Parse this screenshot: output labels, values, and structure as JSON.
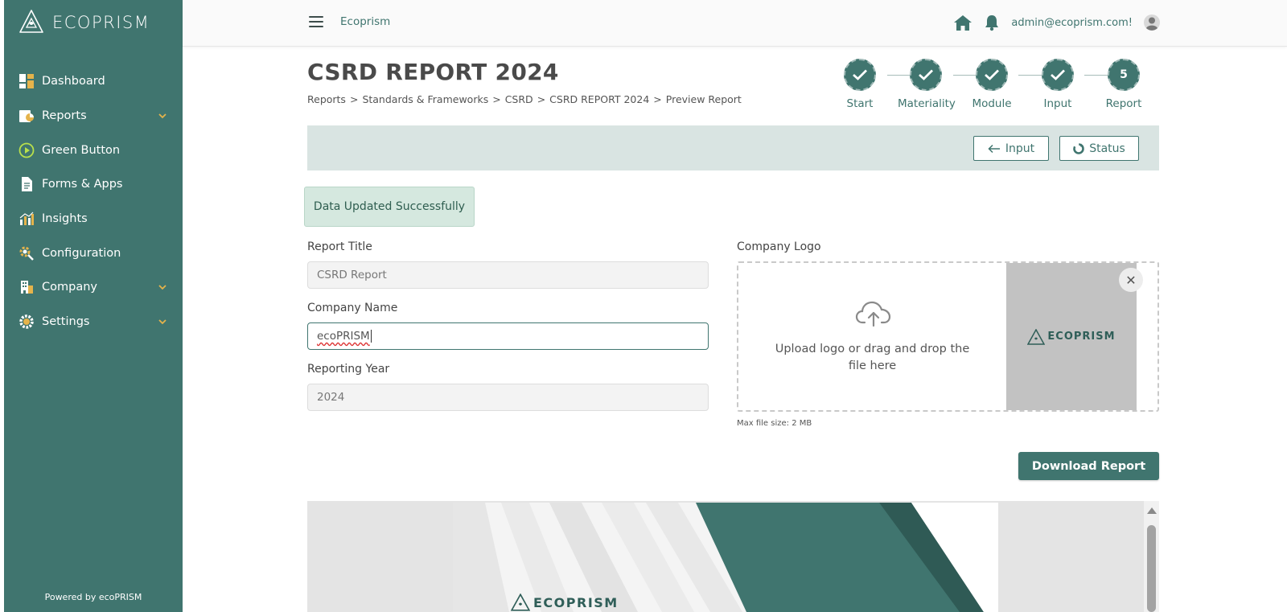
{
  "brand": {
    "name": "ECOPRISM"
  },
  "sidebar": {
    "items": [
      {
        "label": "Dashboard",
        "icon": "dashboard-icon",
        "has_chevron": false
      },
      {
        "label": "Reports",
        "icon": "reports-icon",
        "has_chevron": true
      },
      {
        "label": "Green Button",
        "icon": "play-circle-icon",
        "has_chevron": false
      },
      {
        "label": "Forms & Apps",
        "icon": "document-icon",
        "has_chevron": false
      },
      {
        "label": "Insights",
        "icon": "bar-chart-icon",
        "has_chevron": false
      },
      {
        "label": "Configuration",
        "icon": "gear-search-icon",
        "has_chevron": false
      },
      {
        "label": "Company",
        "icon": "building-icon",
        "has_chevron": true
      },
      {
        "label": "Settings",
        "icon": "settings-icon",
        "has_chevron": true
      }
    ],
    "powered_by": "Powered by ecoPRISM"
  },
  "header": {
    "title": "Ecoprism",
    "email": "admin@ecoprism.com!"
  },
  "page": {
    "title": "CSRD REPORT 2024",
    "breadcrumb": [
      "Reports",
      "Standards & Frameworks",
      "CSRD",
      "CSRD REPORT 2024",
      "Preview Report"
    ]
  },
  "stepper": {
    "steps": [
      {
        "label": "Start",
        "done": true
      },
      {
        "label": "Materiality",
        "done": true
      },
      {
        "label": "Module",
        "done": true
      },
      {
        "label": "Input",
        "done": true
      },
      {
        "label": "Report",
        "done": false,
        "number": "5"
      }
    ]
  },
  "actions": {
    "input_label": "Input",
    "status_label": "Status"
  },
  "toast": {
    "message": "Data Updated Successfully"
  },
  "form": {
    "report_title_label": "Report Title",
    "report_title_value": "CSRD Report",
    "company_name_label": "Company Name",
    "company_name_value": "ecoPRISM",
    "reporting_year_label": "Reporting Year",
    "reporting_year_value": "2024",
    "company_logo_label": "Company Logo",
    "upload_text": "Upload logo or drag and drop the file here",
    "preview_logo_text": "ECOPRISM",
    "max_size": "Max file size: 2 MB"
  },
  "download_label": "Download Report",
  "report_preview": {
    "logo_text": "ECOPRISM"
  },
  "colors": {
    "primary": "#40756f",
    "actionbar": "#d9e4e2",
    "toast_bg": "#d5e8df",
    "chevron": "#e5b34b"
  }
}
